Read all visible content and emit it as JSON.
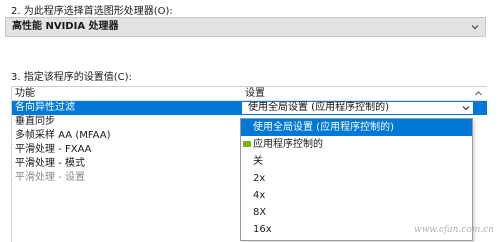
{
  "section2": {
    "label": "2. 为此程序选择首选图形处理器(O):",
    "selected_processor": "高性能 NVIDIA 处理器"
  },
  "section3": {
    "label": "3. 指定该程序的设置值(C):",
    "headers": {
      "feature": "功能",
      "setting": "设置"
    },
    "rows": [
      {
        "feature": "各向异性过滤",
        "setting": "使用全局设置 (应用程序控制的)"
      },
      {
        "feature": "垂直同步"
      },
      {
        "feature": "多帧采样 AA (MFAA)"
      },
      {
        "feature": "平滑处理 - FXAA"
      },
      {
        "feature": "平滑处理 - 模式"
      },
      {
        "feature": "平滑处理 - 设置"
      }
    ],
    "dropdown_options": [
      "使用全局设置 (应用程序控制的)",
      "应用程序控制的",
      "关",
      "2x",
      "4x",
      "8X",
      "16x"
    ]
  },
  "watermark": "www.cfan.com.cn",
  "colors": {
    "accent": "#0078d7",
    "nvidia_green": "#76b900"
  }
}
